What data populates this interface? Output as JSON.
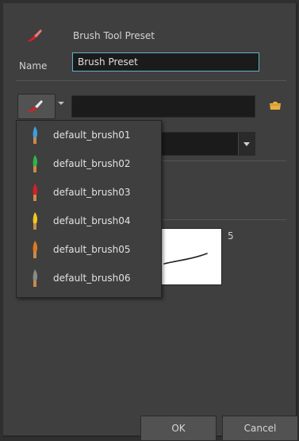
{
  "dialog": {
    "title": "Brush Tool Preset",
    "name_label": "Name",
    "name_value": "Brush Preset",
    "size_value": "5",
    "ok_label": "OK",
    "cancel_label": "Cancel"
  },
  "presets": [
    {
      "label": "default_brush01",
      "color": "#3d9fe0"
    },
    {
      "label": "default_brush02",
      "color": "#2fb548"
    },
    {
      "label": "default_brush03",
      "color": "#d81f26"
    },
    {
      "label": "default_brush04",
      "color": "#f2c61f"
    },
    {
      "label": "default_brush05",
      "color": "#e07a1f"
    },
    {
      "label": "default_brush06",
      "color": "#8a8a8a"
    }
  ],
  "colors": {
    "accent_border": "#5fb3c9",
    "brush_red": "#d81f26",
    "folder": "#e8b040"
  }
}
